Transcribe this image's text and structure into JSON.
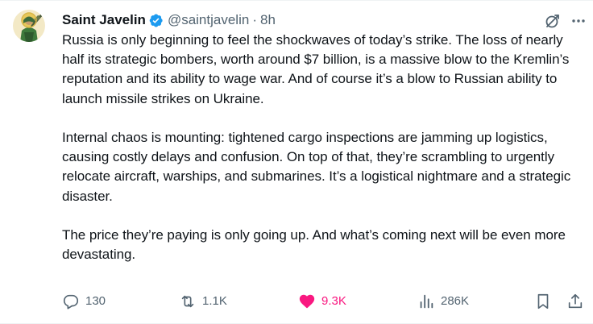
{
  "tweet": {
    "author": {
      "display_name": "Saint Javelin",
      "handle": "@saintjavelin",
      "separator": "·",
      "time": "8h"
    },
    "paragraphs": [
      "Russia is only beginning to feel the shockwaves of today’s strike. The loss of nearly half its strategic bombers, worth around $7 billion, is a massive blow to the Kremlin’s reputation and its ability to wage war. And of course it’s a blow to Russian ability to launch missile strikes on Ukraine.",
      "Internal chaos is mounting: tightened cargo inspections are jamming up logistics, causing costly delays and confusion. On top of that, they’re scrambling to urgently relocate aircraft, warships, and submarines. It’s a logistical nightmare and a strategic disaster.",
      "The price they’re paying is only going up. And what’s coming next will be even more devastating."
    ],
    "stats": {
      "replies": "130",
      "reposts": "1.1K",
      "likes": "9.3K",
      "views": "286K"
    },
    "liked": true
  },
  "icons": {
    "verified": "verified-badge-icon",
    "grok": "grok-icon",
    "more": "more-icon",
    "reply": "reply-icon",
    "repost": "repost-icon",
    "like": "heart-icon",
    "views": "views-icon",
    "bookmark": "bookmark-icon",
    "share": "share-icon"
  },
  "colors": {
    "text": "#0f1419",
    "secondary": "#536471",
    "verified": "#1d9bf0",
    "like": "#f91880"
  }
}
